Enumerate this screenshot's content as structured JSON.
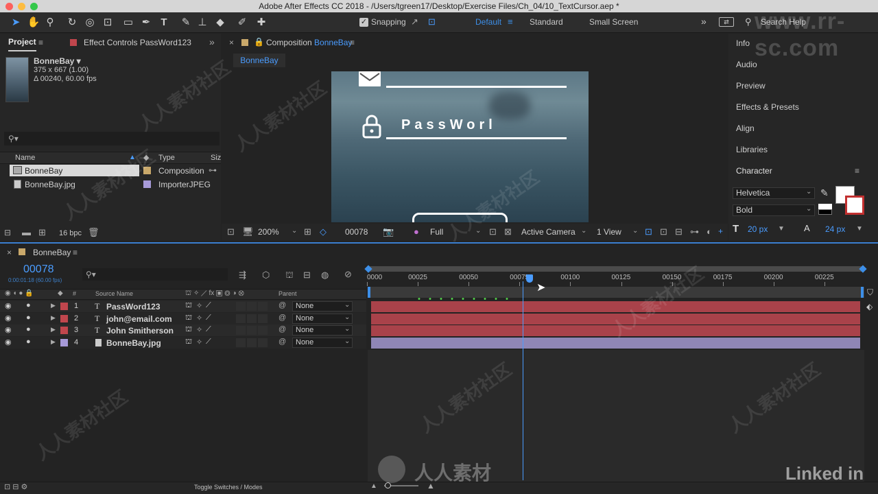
{
  "window": {
    "title": "Adobe After Effects CC 2018 - /Users/tgreen17/Desktop/Exercise Files/Ch_04/10_TextCursor.aep *"
  },
  "toolbar": {
    "snapping_label": "Snapping",
    "workspaces": [
      "Default",
      "Standard",
      "Small Screen"
    ],
    "search_placeholder": "Search Help"
  },
  "project_panel": {
    "tab_project": "Project",
    "tab_effect_controls": "Effect Controls PassWord123",
    "preview_name": "BonneBay ▾",
    "preview_dims": "375 x 667 (1.00)",
    "preview_duration": "Δ 00240, 60.00 fps",
    "search_icon": "search-icon",
    "columns": [
      "Name",
      "Type",
      "Siz"
    ],
    "items": [
      {
        "name": "BonneBay",
        "type": "Composition",
        "color": "#c9a86a"
      },
      {
        "name": "BonneBay.jpg",
        "type": "ImporterJPEG",
        "color": "#a79ad8"
      }
    ],
    "bpc_label": "16 bpc"
  },
  "composition_panel": {
    "tab_prefix": "Composition",
    "tab_name": "BonneBay",
    "breadcrumb": "BonneBay",
    "canvas_text": "PassWorl",
    "zoom": "200%",
    "frame": "00078",
    "resolution": "Full",
    "camera": "Active Camera",
    "views": "1 View"
  },
  "right_panels": {
    "items": [
      "Info",
      "Audio",
      "Preview",
      "Effects & Presets",
      "Align",
      "Libraries",
      "Character"
    ],
    "font_family": "Helvetica",
    "font_style": "Bold",
    "font_size": "20 px",
    "leading": "24 px"
  },
  "timeline": {
    "tab_name": "BonneBay",
    "current_frame": "00078",
    "timecode_sub": "0:00:01:18 (60.00 fps)",
    "columns": {
      "source_name": "Source Name",
      "num": "#",
      "parent": "Parent"
    },
    "layers": [
      {
        "num": "1",
        "type_icon": "T",
        "name": "PassWord123",
        "color": "#c0464d",
        "parent": "None",
        "bar_color": "#a9424a"
      },
      {
        "num": "2",
        "type_icon": "T",
        "name": "john@email.com",
        "color": "#c0464d",
        "parent": "None",
        "bar_color": "#a9424a"
      },
      {
        "num": "3",
        "type_icon": "T",
        "name": "John Smitherson",
        "color": "#c0464d",
        "parent": "None",
        "bar_color": "#a9424a"
      },
      {
        "num": "4",
        "type_icon": "img",
        "name": "BonneBay.jpg",
        "color": "#a79ad8",
        "parent": "None",
        "bar_color": "#8f86b5"
      }
    ],
    "ruler_ticks": [
      "0000",
      "00025",
      "00050",
      "00075",
      "00100",
      "00125",
      "00150",
      "00175",
      "00200",
      "00225"
    ],
    "toggle_label": "Toggle Switches / Modes"
  },
  "watermark": {
    "site": "www.rr-sc.com",
    "cn": "人人素材社区",
    "logo_text": "人人素材",
    "brand": "Linked in"
  }
}
